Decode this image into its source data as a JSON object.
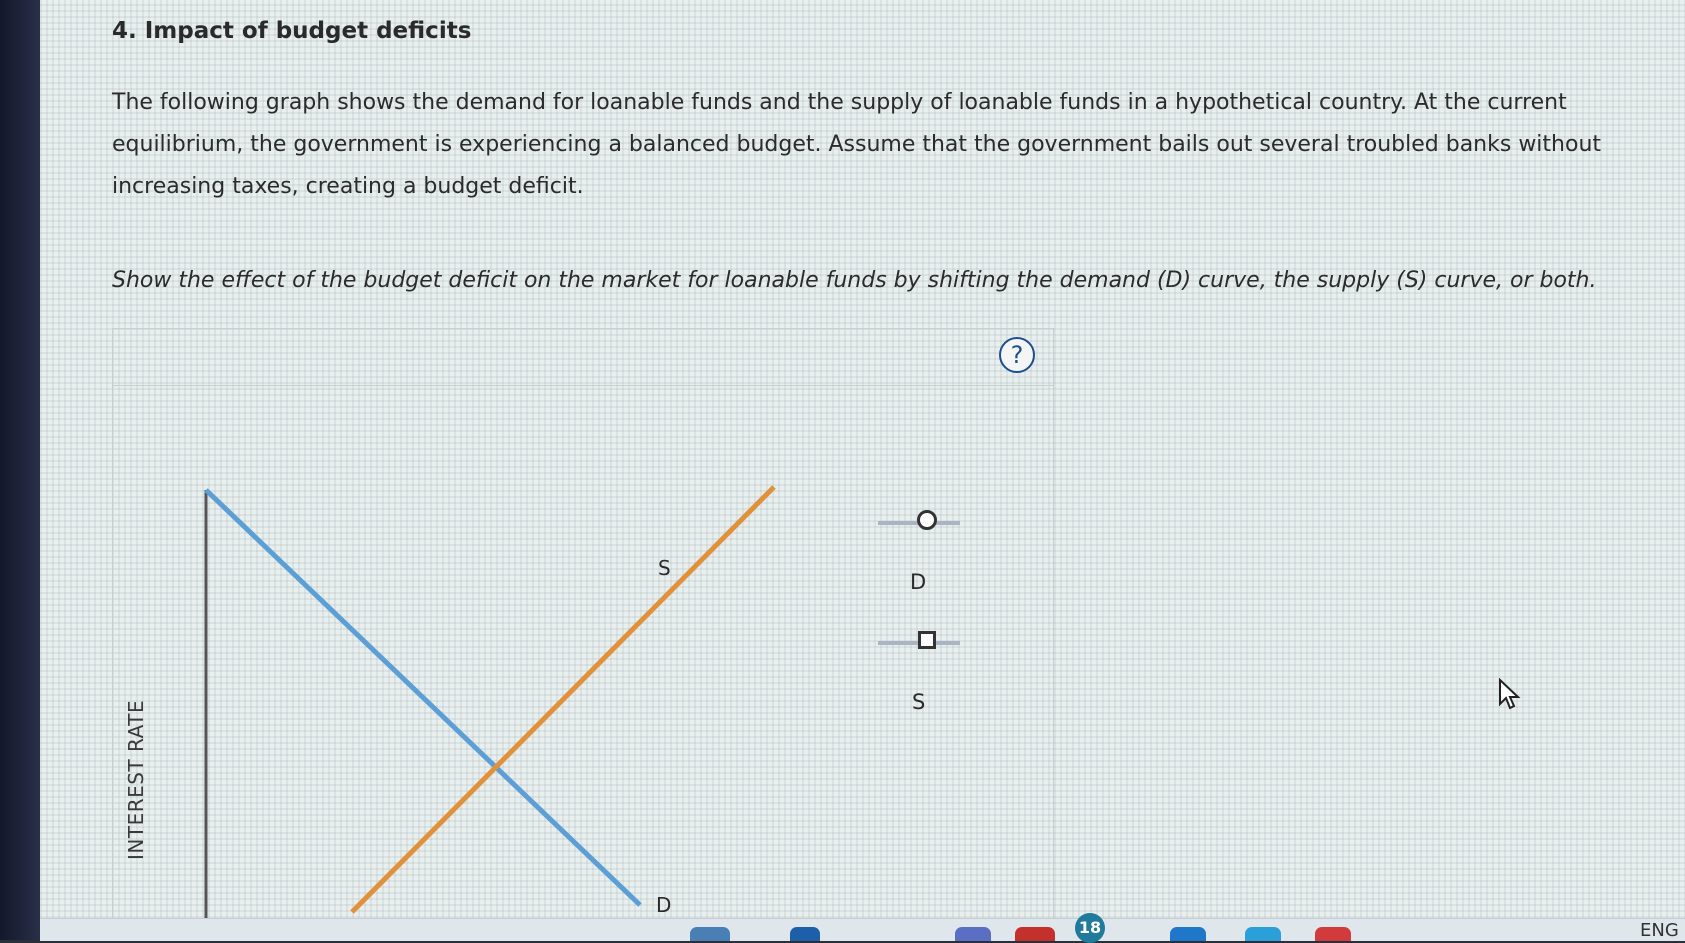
{
  "question": {
    "title": "4. Impact of budget deficits",
    "paragraph": "The following graph shows the demand for loanable funds and the supply of loanable funds in a hypothetical country. At the current equilibrium, the government is experiencing a balanced budget. Assume that the government bails out several troubled banks without increasing taxes, creating a budget deficit.",
    "instruction": "Show the effect of the budget deficit on the market for loanable funds by shifting the demand (D) curve, the supply (S) curve, or both."
  },
  "graph": {
    "help_symbol": "?",
    "y_axis_label": "INTEREST RATE",
    "demand_label": "D",
    "supply_label": "S",
    "colors": {
      "demand": "#5b9fd6",
      "supply": "#e0913a",
      "axis": "#555555"
    }
  },
  "palette": {
    "demand_tool_label": "D",
    "supply_tool_label": "S"
  },
  "taskbar": {
    "notification_count": "18",
    "language": "ENG"
  }
}
